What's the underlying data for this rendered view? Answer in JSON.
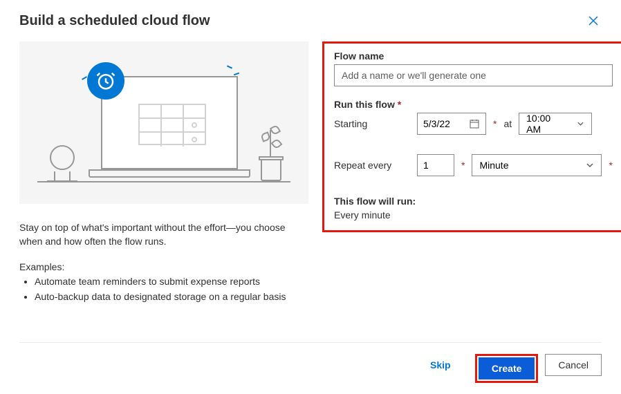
{
  "title": "Build a scheduled cloud flow",
  "description": "Stay on top of what's important without the effort—you choose when and how often the flow runs.",
  "examples_label": "Examples:",
  "examples": [
    "Automate team reminders to submit expense reports",
    "Auto-backup data to designated storage on a regular basis"
  ],
  "form": {
    "name_label": "Flow name",
    "name_placeholder": "Add a name or we'll generate one",
    "run_label": "Run this flow",
    "starting_label": "Starting",
    "starting_date": "5/3/22",
    "at_label": "at",
    "starting_time": "10:00 AM",
    "repeat_label": "Repeat every",
    "repeat_value": "1",
    "repeat_unit": "Minute",
    "summary_label": "This flow will run:",
    "summary_text": "Every minute"
  },
  "buttons": {
    "skip": "Skip",
    "create": "Create",
    "cancel": "Cancel"
  }
}
